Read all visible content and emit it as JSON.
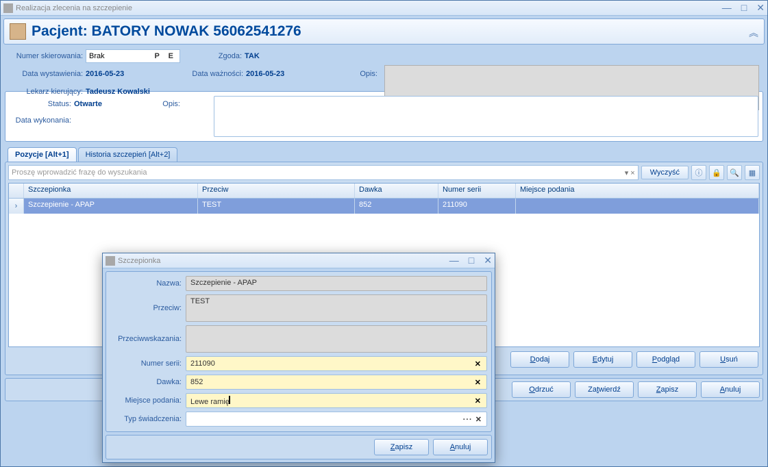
{
  "window": {
    "title": "Realizacja zlecenia na szczepienie"
  },
  "patient": {
    "header": "Pacjent: BATORY NOWAK 56062541276"
  },
  "referral": {
    "numberLabel": "Numer skierowania:",
    "numberValue": "Brak",
    "p": "P",
    "e": "E",
    "consentLabel": "Zgoda:",
    "consentValue": "TAK",
    "issueLabel": "Data wystawienia:",
    "issueValue": "2016-05-23",
    "validLabel": "Data ważności:",
    "validValue": "2016-05-23",
    "opisLabel": "Opis:",
    "doctorLabel": "Lekarz kierujący:",
    "doctorValue": "Tadeusz Kowalski"
  },
  "status": {
    "statusLabel": "Status:",
    "statusValue": "Otwarte",
    "opisLabel": "Opis:",
    "execLabel": "Data wykonania:"
  },
  "tabs": {
    "positions": "Pozycje [Alt+1]",
    "history": "Historia szczepień [Alt+2]"
  },
  "search": {
    "placeholder": "Proszę wprowadzić frazę do wyszukania",
    "clear": "Wyczyść"
  },
  "grid": {
    "headers": {
      "c1": "Szczepionka",
      "c2": "Przeciw",
      "c3": "Dawka",
      "c4": "Numer serii",
      "c5": "Miejsce podania"
    },
    "row": {
      "c1": "Szczepienie - APAP",
      "c2": "TEST",
      "c3": "852",
      "c4": "211090",
      "c5": ""
    }
  },
  "buttons": {
    "add": "Dodaj",
    "edit": "Edytuj",
    "preview": "Podgląd",
    "delete": "Usuń",
    "reject": "Odrzuć",
    "approve": "Zatwierdź",
    "save": "Zapisz",
    "cancel": "Anuluj"
  },
  "dialog": {
    "title": "Szczepionka",
    "name": {
      "label": "Nazwa:",
      "value": "Szczepienie - APAP"
    },
    "against": {
      "label": "Przeciw:",
      "value": "TEST"
    },
    "contra": {
      "label": "Przeciwwskazania:",
      "value": ""
    },
    "series": {
      "label": "Numer serii:",
      "value": "211090"
    },
    "dose": {
      "label": "Dawka:",
      "value": "852"
    },
    "place": {
      "label": "Miejsce podania:",
      "value": "Lewe ramię"
    },
    "type": {
      "label": "Typ świadczenia:",
      "value": ""
    },
    "save": "Zapisz",
    "cancel": "Anuluj"
  }
}
